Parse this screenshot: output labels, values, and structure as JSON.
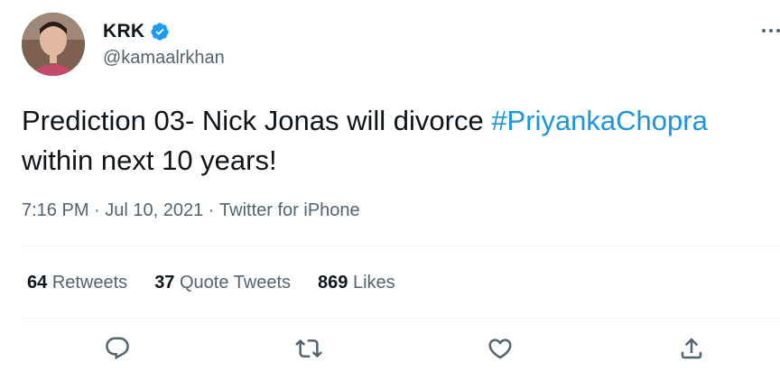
{
  "author": {
    "display_name": "KRK",
    "handle": "@kamaalrkhan",
    "verified": true
  },
  "tweet": {
    "text_before": "Prediction 03- Nick Jonas will divorce ",
    "hashtag": "#PriyankaChopra",
    "text_after": "within next 10 years!",
    "time": "7:16 PM",
    "separator1": " · ",
    "date": "Jul 10, 2021",
    "separator2": " · ",
    "source": "Twitter for iPhone"
  },
  "stats": {
    "retweets_count": "64",
    "retweets_label": "Retweets",
    "quotes_count": "37",
    "quotes_label": "Quote Tweets",
    "likes_count": "869",
    "likes_label": "Likes"
  },
  "colors": {
    "accent": "#1b95e0",
    "verified": "#1d9bf0",
    "muted": "#536471",
    "text": "#0f1419"
  },
  "icons": {
    "reply": "reply-icon",
    "retweet": "retweet-icon",
    "like": "like-icon",
    "share": "share-icon",
    "more": "more-icon",
    "verified": "verified-badge-icon"
  }
}
